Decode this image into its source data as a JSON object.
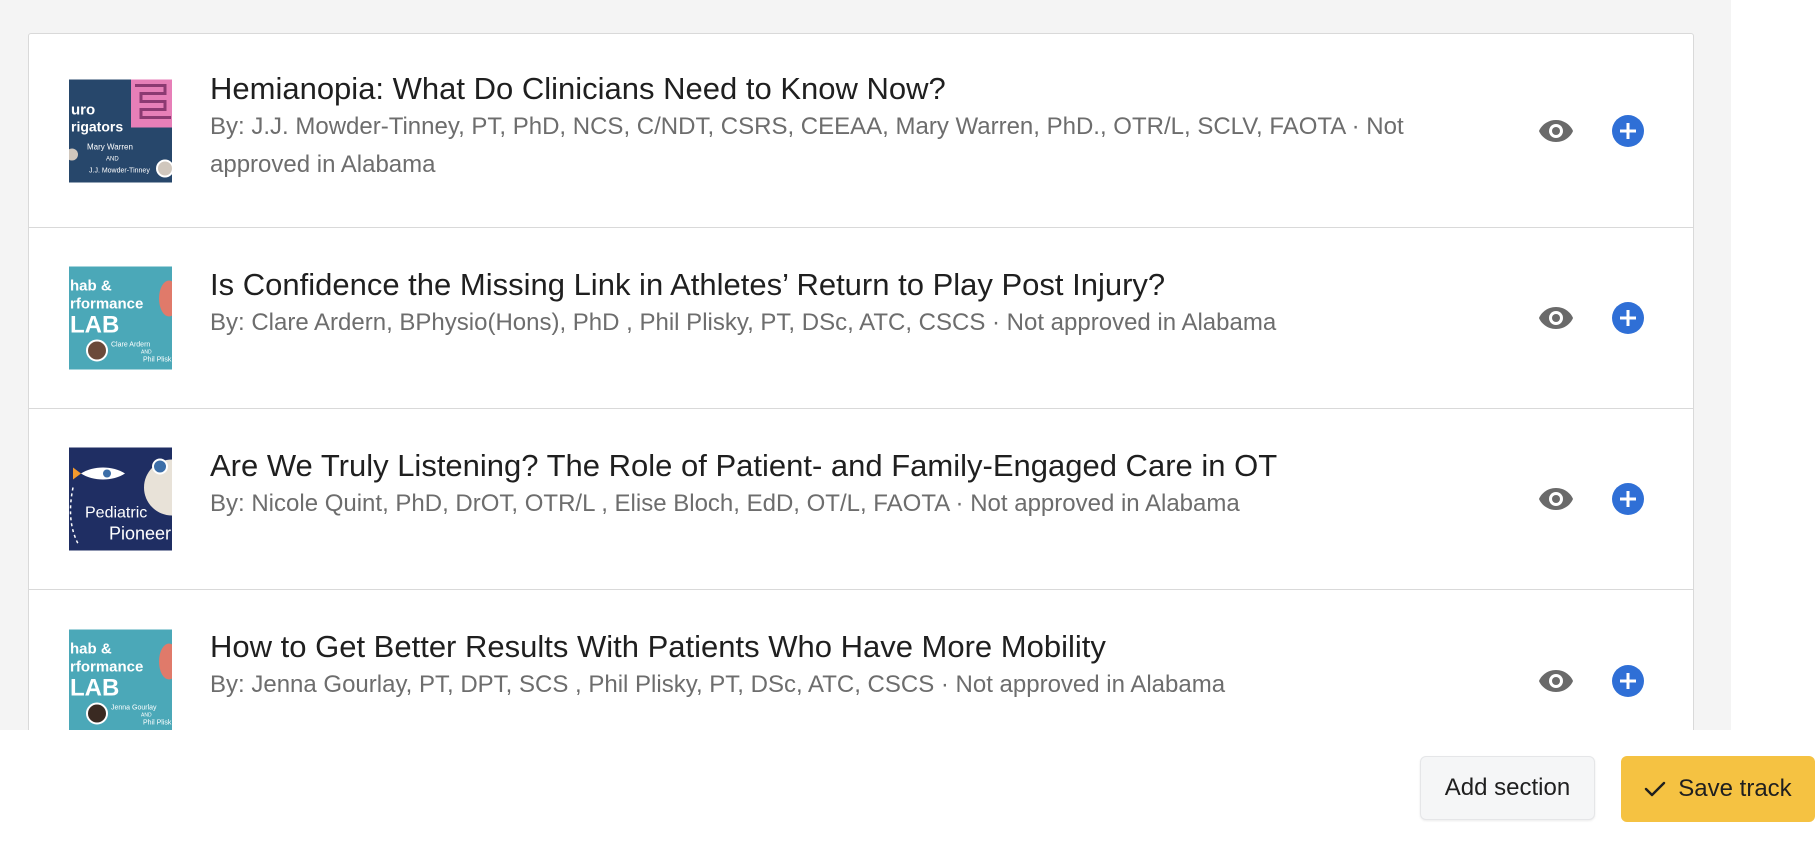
{
  "courses": [
    {
      "title": "Hemianopia: What Do Clinicians Need to Know Now?",
      "meta": "By: J.J. Mowder-Tinney, PT, PhD, NCS, C/NDT, CSRS, CEEAA, Mary Warren, PhD., OTR/L, SCLV, FAOTA · Not approved in Alabama",
      "thumbnail_text": [
        "uro",
        "rigators",
        "Mary Warren",
        "AND",
        "J.J. Mowder-Tinney"
      ]
    },
    {
      "title": "Is Confidence the Missing Link in Athletes’ Return to Play Post Injury?",
      "meta": "By: Clare Ardern, BPhysio(Hons), PhD , Phil Plisky, PT, DSc, ATC, CSCS · Not approved in Alabama",
      "thumbnail_text": [
        "hab &",
        "rformance",
        "LAB",
        "Clare Ardern",
        "AND",
        "Phil Plisk"
      ]
    },
    {
      "title": "Are We Truly Listening? The Role of Patient- and Family-Engaged Care in OT",
      "meta": "By: Nicole Quint, PhD, DrOT, OTR/L , Elise Bloch, EdD, OT/L, FAOTA · Not approved in Alabama",
      "thumbnail_text": [
        "Pediatric",
        "Pioneer"
      ]
    },
    {
      "title": "How to Get Better Results With Patients Who Have More Mobility",
      "meta": "By: Jenna Gourlay, PT, DPT, SCS , Phil Plisky, PT, DSc, ATC, CSCS · Not approved in Alabama",
      "thumbnail_text": [
        "hab &",
        "rformance",
        "LAB",
        "Jenna Gourlay",
        "AND",
        "Phil Plisk"
      ]
    }
  ],
  "footer": {
    "add_section_label": "Add section",
    "save_track_label": "Save track"
  },
  "colors": {
    "accent_blue": "#2f6fd6",
    "save_yellow": "#f5c242",
    "eye_gray": "#6a6a6a"
  },
  "icons": {
    "preview": "eye-icon",
    "add": "plus-circle-icon",
    "save": "check-icon"
  }
}
